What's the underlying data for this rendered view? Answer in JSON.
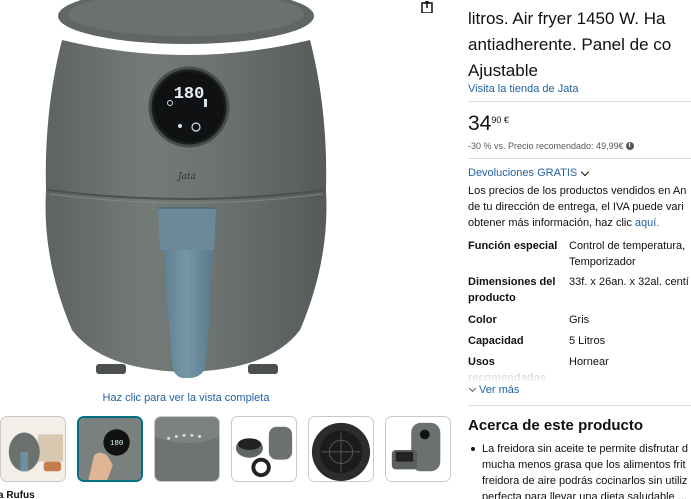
{
  "gallery": {
    "brand_logo_text": "Jata",
    "display_temperature": "180",
    "full_view_link": "Haz clic para ver la vista completa",
    "bottom_text": "a Rufus",
    "thumbnails": [
      {
        "name": "thumb-air-fryer-kitchen",
        "selected": false
      },
      {
        "name": "thumb-touch-panel",
        "selected": true
      },
      {
        "name": "thumb-panel-closeup",
        "selected": false
      },
      {
        "name": "thumb-basket-accessories",
        "selected": false
      },
      {
        "name": "thumb-basket-top",
        "selected": false
      },
      {
        "name": "thumb-drawer-open",
        "selected": false
      }
    ]
  },
  "product": {
    "title_lines": [
      "litros. Air fryer 1450 W. Ha",
      "antiadherente. Panel de co",
      "Ajustable"
    ],
    "store_link": "Visita la tienda de Jata",
    "price_whole": "34",
    "price_fraction": "90 €",
    "discount_text": "-30 % vs. Precio recomendado: 49,99€",
    "returns_label": "Devoluciones GRATIS",
    "price_note_lines": [
      "Los precios de los productos vendidos en An",
      "de tu dirección de entrega, el IVA puede vari",
      "obtener más información, haz clic "
    ],
    "price_note_link": "aquí.",
    "specs": [
      {
        "key_lines": [
          "Función especial"
        ],
        "value_lines": [
          "Control de temperatura,",
          "Temporizador"
        ]
      },
      {
        "key_lines": [
          "Dimensiones del",
          "producto"
        ],
        "value_lines": [
          "33f. x 26an. x 32al. centí"
        ]
      },
      {
        "key_lines": [
          "Color"
        ],
        "value_lines": [
          "Gris"
        ]
      },
      {
        "key_lines": [
          "Capacidad"
        ],
        "value_lines": [
          "5 Litros"
        ]
      },
      {
        "key_lines": [
          "Usos",
          "recomendados"
        ],
        "value_lines": [
          "Hornear"
        ]
      }
    ],
    "ver_mas": "Ver más",
    "about_title": "Acerca de este producto",
    "about_lines": [
      "La freidora sin aceite te permite disfrutar d",
      "mucha menos grasa que los alimentos frit",
      "freidora de aire podrás cocinarlos sin utiliz",
      "perfecta para llevar una dieta saludable ..."
    ]
  },
  "colors": {
    "link": "#2162a1",
    "fryer_body": "#6e7471",
    "handle": "#6f8fa0",
    "selected_thumb_border": "#007185"
  }
}
